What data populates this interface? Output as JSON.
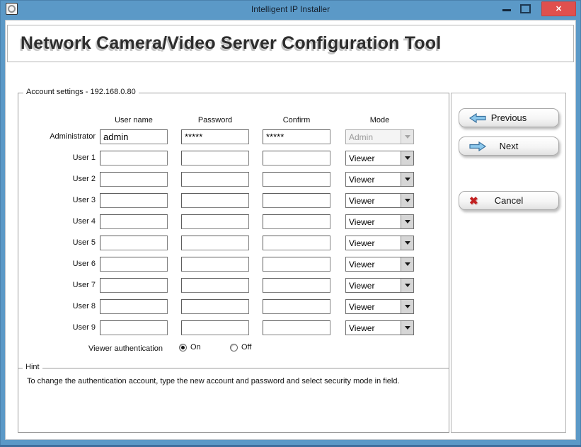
{
  "window": {
    "title": "Intelligent IP Installer"
  },
  "icons": {
    "close": "✕",
    "cancel_x": "✖",
    "minimize": "–",
    "maximize": "□",
    "dropdown": "▼"
  },
  "header": {
    "title": "Network Camera/Video Server Configuration Tool"
  },
  "account": {
    "group_title": "Account settings - 192.168.0.80",
    "columns": [
      "User name",
      "Password",
      "Confirm",
      "Mode"
    ],
    "rows": [
      {
        "label": "Administrator",
        "username": "admin",
        "password": "*****",
        "confirm": "*****",
        "mode": "Admin",
        "mode_disabled": true
      },
      {
        "label": "User 1",
        "username": "",
        "password": "",
        "confirm": "",
        "mode": "Viewer",
        "mode_disabled": false
      },
      {
        "label": "User 2",
        "username": "",
        "password": "",
        "confirm": "",
        "mode": "Viewer",
        "mode_disabled": false
      },
      {
        "label": "User 3",
        "username": "",
        "password": "",
        "confirm": "",
        "mode": "Viewer",
        "mode_disabled": false
      },
      {
        "label": "User 4",
        "username": "",
        "password": "",
        "confirm": "",
        "mode": "Viewer",
        "mode_disabled": false
      },
      {
        "label": "User 5",
        "username": "",
        "password": "",
        "confirm": "",
        "mode": "Viewer",
        "mode_disabled": false
      },
      {
        "label": "User 6",
        "username": "",
        "password": "",
        "confirm": "",
        "mode": "Viewer",
        "mode_disabled": false
      },
      {
        "label": "User 7",
        "username": "",
        "password": "",
        "confirm": "",
        "mode": "Viewer",
        "mode_disabled": false
      },
      {
        "label": "User 8",
        "username": "",
        "password": "",
        "confirm": "",
        "mode": "Viewer",
        "mode_disabled": false
      },
      {
        "label": "User 9",
        "username": "",
        "password": "",
        "confirm": "",
        "mode": "Viewer",
        "mode_disabled": false
      }
    ],
    "viewer_auth": {
      "label": "Viewer authentication",
      "on_label": "On",
      "off_label": "Off",
      "selected": "On"
    }
  },
  "hint": {
    "group_title": "Hint",
    "text": "To change the authentication account, type the new account and password and select security mode in field."
  },
  "nav": {
    "previous": "Previous",
    "next": "Next",
    "cancel": "Cancel"
  },
  "colors": {
    "titlebar_blue": "#5b99c7",
    "close_red": "#e0504e",
    "arrow_blue": "#8cc8ec",
    "cancel_red": "#c21f1f"
  }
}
